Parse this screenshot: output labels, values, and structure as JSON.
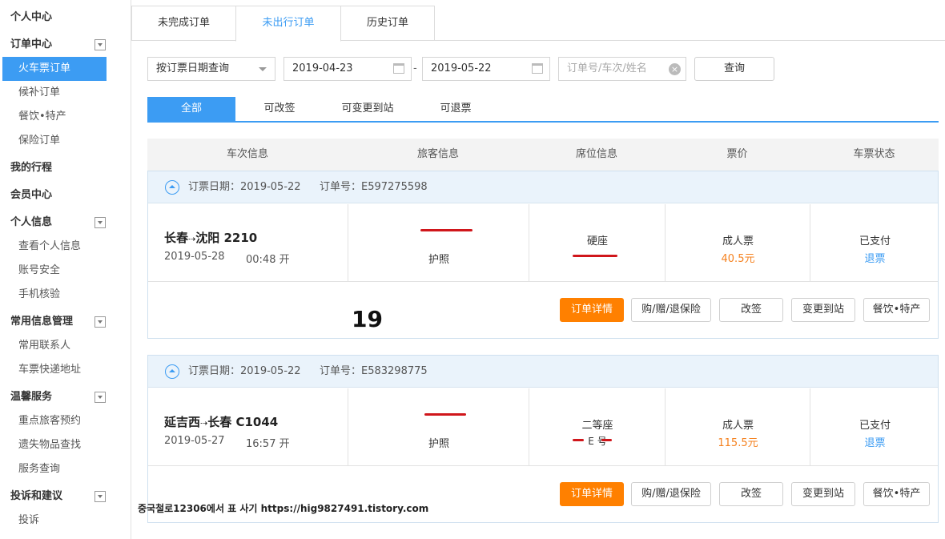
{
  "sidebar": [
    {
      "label": "个人中心",
      "kind": "head",
      "toggle": false
    },
    {
      "label": "订单中心",
      "kind": "head",
      "toggle": true
    },
    {
      "label": "火车票订单",
      "kind": "item",
      "active": true
    },
    {
      "label": "候补订单",
      "kind": "item"
    },
    {
      "label": "餐饮•特产",
      "kind": "item"
    },
    {
      "label": "保险订单",
      "kind": "item"
    },
    {
      "label": "我的行程",
      "kind": "head",
      "toggle": false
    },
    {
      "label": "会员中心",
      "kind": "head",
      "toggle": false
    },
    {
      "label": "个人信息",
      "kind": "head",
      "toggle": true
    },
    {
      "label": "查看个人信息",
      "kind": "item"
    },
    {
      "label": "账号安全",
      "kind": "item"
    },
    {
      "label": "手机核验",
      "kind": "item"
    },
    {
      "label": "常用信息管理",
      "kind": "head",
      "toggle": true
    },
    {
      "label": "常用联系人",
      "kind": "item"
    },
    {
      "label": "车票快递地址",
      "kind": "item"
    },
    {
      "label": "温馨服务",
      "kind": "head",
      "toggle": true
    },
    {
      "label": "重点旅客预约",
      "kind": "item"
    },
    {
      "label": "遗失物品查找",
      "kind": "item"
    },
    {
      "label": "服务查询",
      "kind": "item"
    },
    {
      "label": "投诉和建议",
      "kind": "head",
      "toggle": true
    },
    {
      "label": "投诉",
      "kind": "item"
    }
  ],
  "tabs": [
    "未完成订单",
    "未出行订单",
    "历史订单"
  ],
  "filters": {
    "query_type": "按订票日期查询",
    "date_from": "2019-04-23",
    "date_sep": "-",
    "date_to": "2019-05-22",
    "search_placeholder": "订单号/车次/姓名",
    "query_button": "查询"
  },
  "subtabs": [
    "全部",
    "可改签",
    "可变更到站",
    "可退票"
  ],
  "columns": [
    "车次信息",
    "旅客信息",
    "席位信息",
    "票价",
    "车票状态"
  ],
  "orders": [
    {
      "booking_date": "订票日期：2019-05-22",
      "order_no": "订单号：E597275598",
      "route_from": "长春",
      "route_arrow": "⇢",
      "route_to": "沈阳",
      "train_no": "2210",
      "depart_date": "2019-05-28",
      "depart_time": "00:48 开",
      "id_type": "护照",
      "seat": "硬座",
      "seat_detail": "",
      "ticket_type": "成人票",
      "price": "40.5元",
      "status": "已支付",
      "refund_link": "退票"
    },
    {
      "booking_date": "订票日期：2019-05-22",
      "order_no": "订单号：E583298775",
      "route_from": "延吉西",
      "route_arrow": "⇢",
      "route_to": "长春",
      "train_no": "C1044",
      "depart_date": "2019-05-27",
      "depart_time": "16:57 开",
      "id_type": "护照",
      "seat": "二等座",
      "seat_detail": "E    号",
      "ticket_type": "成人票",
      "price": "115.5元",
      "status": "已支付",
      "refund_link": "退票"
    }
  ],
  "actions": [
    "订单详情",
    "购/赠/退保险",
    "改签",
    "变更到站",
    "餐饮•特产"
  ],
  "overlay_number": "19",
  "footer_note": "중국철로12306에서 표 사기   https://hig9827491.tistory.com",
  "colors": {
    "accent": "#3c9cf3",
    "primary_button": "#ff8000",
    "price": "#f58220",
    "redaction": "#d0161b"
  }
}
